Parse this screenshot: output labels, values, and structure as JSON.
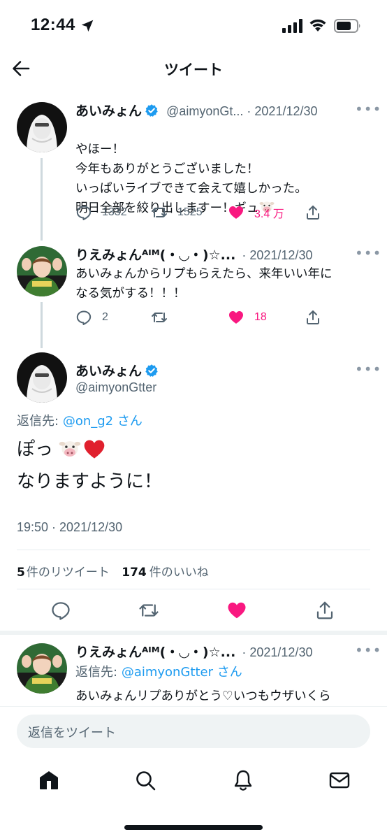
{
  "status_bar": {
    "time": "12:44"
  },
  "header": {
    "title": "ツイート"
  },
  "thread": [
    {
      "name": "あいみょん",
      "handle_date": "@aimyonGt... · 2021/12/30",
      "text": "やほー！\n今年もありがとうございました！\nいっぱいライブできて会えて嬉しかった。\n明日全部を絞り出しますー！ギュ",
      "replies": "1332",
      "retweets": "1525",
      "likes": "3.4 万"
    },
    {
      "name": "りえみょんᴬᴵᴹ(・◡・)☆...",
      "handle_date": "2021/12/30",
      "text": "あいみょんからリプもらえたら、来年いい年に\nなる気がする！！！",
      "replies": "2",
      "retweets": "",
      "likes": "18"
    }
  ],
  "main_tweet": {
    "name": "あいみょん",
    "handle": "@aimyonGtter",
    "reply_to_label": "返信先:",
    "reply_to_user": "@on_g2",
    "reply_to_suffix": "さん",
    "line1": "ぽっ",
    "line2": "なりますように！",
    "timestamp": "19:50 · 2021/12/30",
    "retweet_count": "5",
    "retweet_label": "件のリツイート",
    "like_count": "174",
    "like_label": "件のいいね"
  },
  "reply_tweet": {
    "name": "りえみょんᴬᴵᴹ(・◡・)☆...",
    "date": "2021/12/30",
    "reply_to_label": "返信先:",
    "reply_to_user": "@aimyonGtter",
    "reply_to_suffix": "さん",
    "text": "あいみょんリプありがとう♡いつもウザいくら"
  },
  "compose": {
    "placeholder": "返信をツイート"
  },
  "bottom_nav": [
    "home-icon",
    "search-icon",
    "notifications-icon",
    "messages-icon"
  ],
  "colors": {
    "link": "#1d9bf0",
    "like": "#f91880",
    "secondary": "#536471",
    "verified": "#1d9bf0"
  }
}
